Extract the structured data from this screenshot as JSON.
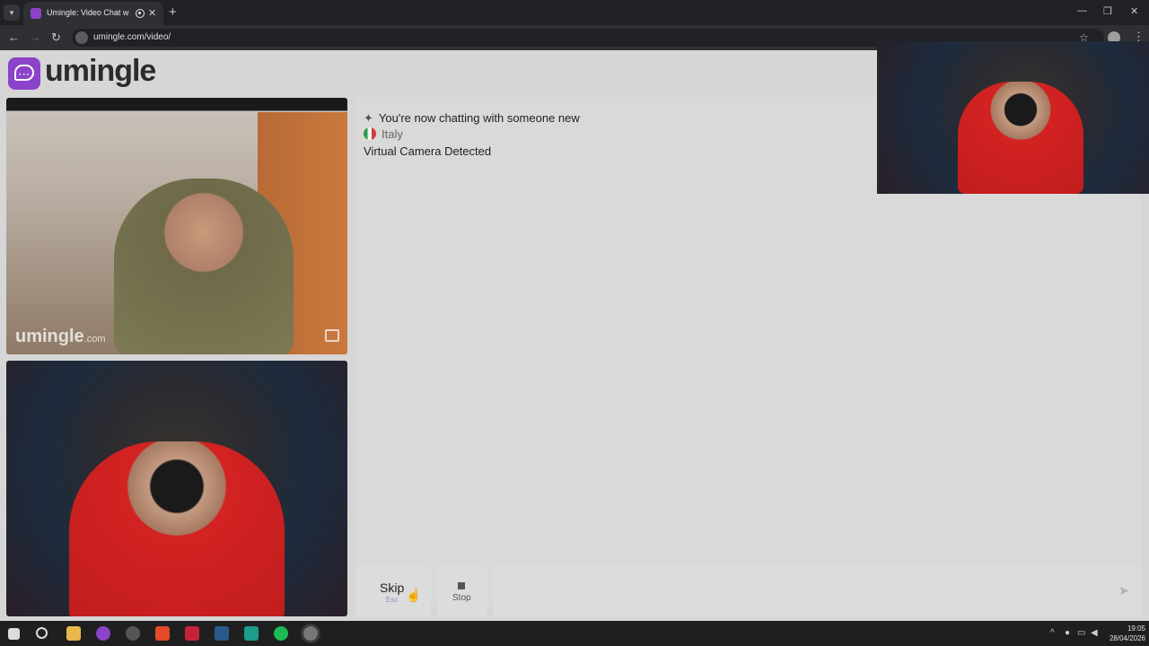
{
  "browser": {
    "tab_title": "Umingle: Video Chat with S",
    "url": "umingle.com/video/"
  },
  "site": {
    "logo_text": "umingle",
    "brand_color": "#8a43c9"
  },
  "stranger_video": {
    "watermark": "umingle",
    "watermark_suffix": ".com"
  },
  "chat": {
    "messages": [
      {
        "icon": "sparkle-icon",
        "text": "You're now chatting with someone new"
      },
      {
        "icon": "italy-flag-icon",
        "text": "Italy"
      },
      {
        "icon": "",
        "text": "Virtual Camera Detected"
      }
    ]
  },
  "controls": {
    "skip_label": "Skip",
    "skip_hint": "Esc",
    "stop_label": "Stop",
    "message_placeholder": ""
  },
  "taskbar": {
    "time": "19:05",
    "date": "28/04/2026"
  }
}
